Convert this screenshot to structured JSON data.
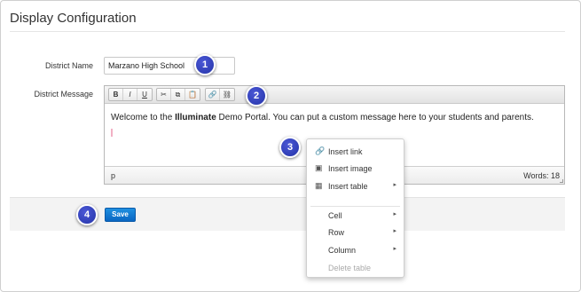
{
  "section": {
    "title": "Display Configuration"
  },
  "form": {
    "district_name_label": "District Name",
    "district_name_value": "Marzano High School",
    "district_message_label": "District Message"
  },
  "editor": {
    "toolbar": {
      "buttons": [
        "B",
        "I",
        "U",
        "✂",
        "⧉",
        "📋",
        "🔗",
        "⛓"
      ]
    },
    "content_before_bold": "Welcome to the ",
    "content_bold": "Illuminate",
    "content_after_bold": " Demo Portal. You can put a custom message here to your students and parents.",
    "status_path": "p",
    "word_count": "Words: 18"
  },
  "actions": {
    "save_label": "Save"
  },
  "context_menu": {
    "items": [
      {
        "label": "Insert link",
        "icon": "link-icon",
        "glyph": "🔗",
        "submenu": false,
        "disabled": false
      },
      {
        "label": "Insert image",
        "icon": "image-icon",
        "glyph": "▣",
        "submenu": false,
        "disabled": false
      },
      {
        "label": "Insert table",
        "icon": "table-icon",
        "glyph": "▦",
        "submenu": true,
        "disabled": false
      },
      {
        "label": "Cell",
        "icon": "",
        "glyph": "",
        "submenu": true,
        "disabled": false
      },
      {
        "label": "Row",
        "icon": "",
        "glyph": "",
        "submenu": true,
        "disabled": false
      },
      {
        "label": "Column",
        "icon": "",
        "glyph": "",
        "submenu": true,
        "disabled": false
      },
      {
        "label": "Delete table",
        "icon": "",
        "glyph": "",
        "submenu": false,
        "disabled": true
      }
    ],
    "submenu_arrow": "▸"
  },
  "callouts": [
    "1",
    "2",
    "3",
    "4"
  ],
  "colors": {
    "accent": "#0a66c2",
    "callout": "#2a38b0"
  }
}
